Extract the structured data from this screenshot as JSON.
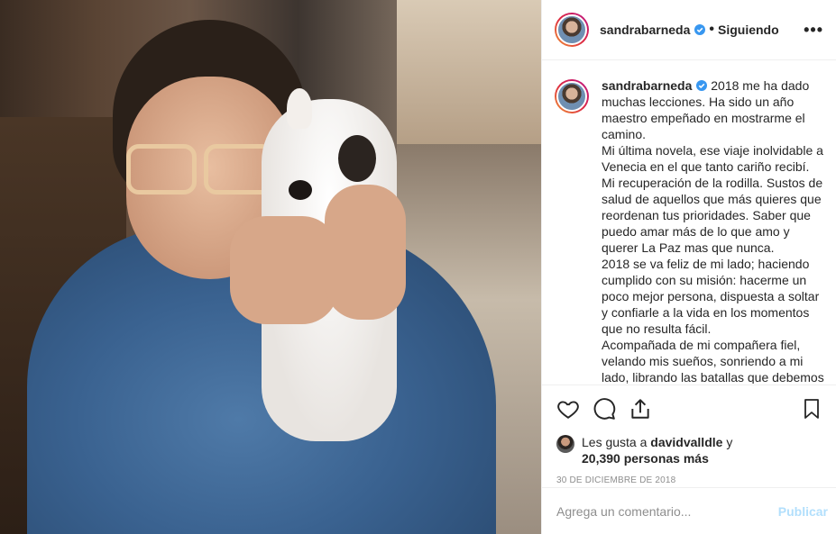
{
  "post": {
    "username": "sandrabarneda",
    "follow_status": "Siguiendo",
    "dot": "•",
    "more": "•••",
    "caption_user": "sandrabarneda",
    "caption": "2018 me ha dado muchas lecciones. Ha sido un año maestro empeñado en mostrarme el camino.\nMi última novela, ese viaje inolvidable a Venecia en el que tanto cariño recibí. Mi recuperación de la rodilla. Sustos de salud de aquellos que más quieres que reordenan tus prioridades. Saber que puedo amar más de lo que amo y querer La Paz mas que nunca.\n2018 se va feliz de mi lado; haciendo cumplido con su misión: hacerme un poco mejor persona, dispuesta a soltar y confiarle a la vida en los momentos que no resulta fácil.\nAcompañada de mi compañera fiel, velando mis sueños, sonriendo a mi lado, librando las batallas que debemos",
    "likes_prefix": "Les gusta a ",
    "likes_user": "davidvalldle",
    "likes_join": " y",
    "likes_count": "20,390 personas más",
    "date": "30 DE DICIEMBRE DE 2018",
    "comment_placeholder": "Agrega un comentario...",
    "post_button": "Publicar"
  },
  "colors": {
    "verified": "#3897f0",
    "post_button_disabled": "#b2dffc",
    "meta": "#8e8e8e"
  },
  "icons": [
    "heart-icon",
    "comment-icon",
    "share-icon",
    "bookmark-icon",
    "verified-badge-icon",
    "more-options-icon"
  ]
}
